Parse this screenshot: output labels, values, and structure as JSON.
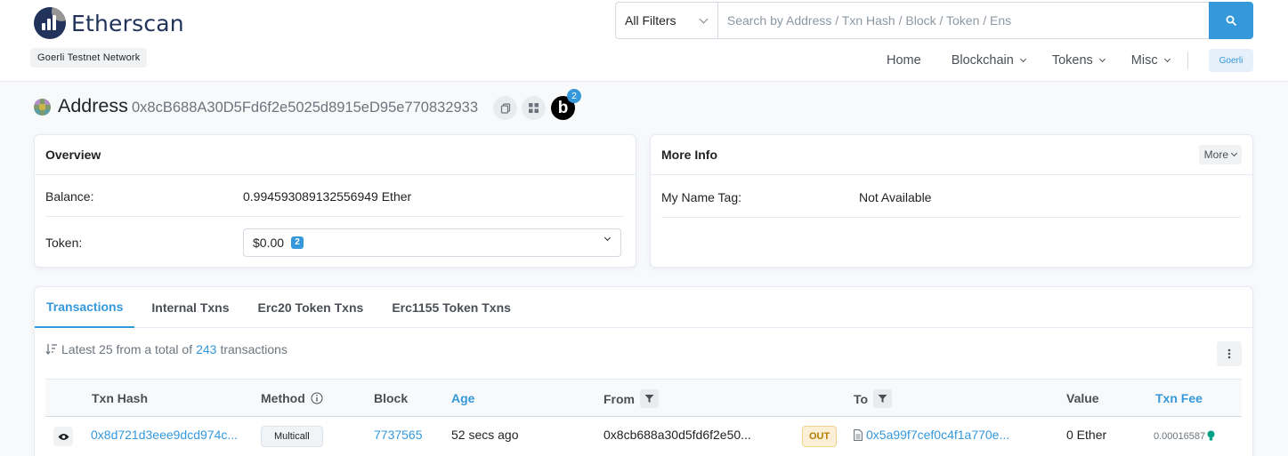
{
  "header": {
    "logo_text": "Etherscan",
    "network_label": "Goerli Testnet Network",
    "search": {
      "filter_selected": "All Filters",
      "placeholder": "Search by Address / Txn Hash / Block / Token / Ens"
    },
    "nav": [
      {
        "label": "Home",
        "has_dropdown": false
      },
      {
        "label": "Blockchain",
        "has_dropdown": true
      },
      {
        "label": "Tokens",
        "has_dropdown": true
      },
      {
        "label": "Misc",
        "has_dropdown": true
      }
    ],
    "network_pill": "Goerli"
  },
  "address": {
    "title": "Address",
    "hash": "0x8cB688A30D5Fd6f2e5025d8915eD95e770832933",
    "blockscan_letter": "b",
    "blockscan_count": "2"
  },
  "overview": {
    "title": "Overview",
    "balance_label": "Balance:",
    "balance_value": "0.994593089132556949 Ether",
    "token_label": "Token:",
    "token_value": "$0.00",
    "token_count": "2"
  },
  "more_info": {
    "title": "More Info",
    "more_button": "More",
    "name_tag_label": "My Name Tag:",
    "name_tag_value": "Not Available"
  },
  "tabs": [
    {
      "label": "Transactions",
      "active": true
    },
    {
      "label": "Internal Txns",
      "active": false
    },
    {
      "label": "Erc20 Token Txns",
      "active": false
    },
    {
      "label": "Erc1155 Token Txns",
      "active": false
    }
  ],
  "transactions": {
    "summary_prefix": "Latest 25 from a total of",
    "summary_count": "243",
    "summary_suffix": "transactions",
    "columns": {
      "txn_hash": "Txn Hash",
      "method": "Method",
      "block": "Block",
      "age": "Age",
      "from": "From",
      "to": "To",
      "value": "Value",
      "txn_fee": "Txn Fee"
    },
    "rows": [
      {
        "txn_hash": "0x8d721d3eee9dcd974c...",
        "method": "Multicall",
        "block": "7737565",
        "age": "52 secs ago",
        "from": "0x8cb688a30d5fd6f2e50...",
        "direction": "OUT",
        "to": "0x5a99f7cef0c4f1a770e...",
        "value": "0 Ether",
        "txn_fee": "0.00016587"
      }
    ]
  },
  "colors": {
    "accent": "#3498db",
    "brand_dark": "#21325b",
    "out_badge_bg": "#fbf0d7",
    "out_badge_text": "#b47d00"
  }
}
